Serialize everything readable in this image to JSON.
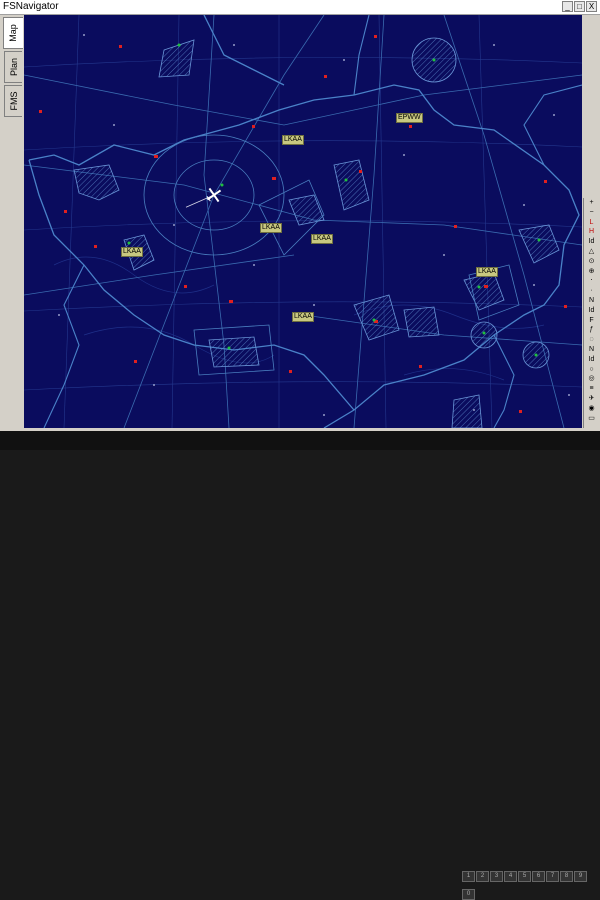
{
  "window": {
    "title": "FSNavigator"
  },
  "titlebar_buttons": [
    "_",
    "□",
    "X"
  ],
  "tabs": [
    {
      "label": "Map",
      "active": true,
      "icon": "globe-icon"
    },
    {
      "label": "Plan",
      "active": false,
      "icon": "clipboard-icon"
    },
    {
      "label": "FMS",
      "active": false,
      "icon": "document-icon"
    }
  ],
  "map": {
    "labels": [
      {
        "text": "EPWW"
      },
      {
        "text": "LKAA"
      },
      {
        "text": "LKAA"
      },
      {
        "text": "LKAA"
      },
      {
        "text": "LKAA"
      },
      {
        "text": "LKAA"
      },
      {
        "text": "LKAA"
      }
    ],
    "colors": {
      "background": "#0a0c5e",
      "border": "#4a7fc0",
      "grid": "#2a3f9a",
      "airport": "#e02020",
      "vor": "#20c040"
    }
  },
  "toolbar": {
    "buttons": [
      {
        "glyph": "+",
        "icon": "zoom-in-icon"
      },
      {
        "glyph": "−",
        "icon": "zoom-out-icon"
      },
      {
        "glyph": "L",
        "icon": "layer-l-icon"
      },
      {
        "glyph": "H",
        "icon": "layer-h-icon"
      },
      {
        "glyph": "Id",
        "icon": "ident-icon"
      },
      {
        "glyph": "△",
        "icon": "triangle-icon"
      },
      {
        "glyph": "⊙",
        "icon": "vor-icon"
      },
      {
        "glyph": "⊕",
        "icon": "ndb-icon"
      },
      {
        "glyph": "⋅",
        "icon": "dot-icon"
      },
      {
        "glyph": "·",
        "icon": "small-dot-icon"
      },
      {
        "glyph": "N",
        "icon": "n-icon"
      },
      {
        "glyph": "Id",
        "icon": "ident2-icon"
      },
      {
        "glyph": "F",
        "icon": "f-icon"
      },
      {
        "glyph": "ƒ",
        "icon": "func-icon"
      },
      {
        "glyph": "◌",
        "icon": "circle-icon"
      },
      {
        "glyph": "N",
        "icon": "n2-icon"
      },
      {
        "glyph": "Id",
        "icon": "ident3-icon"
      },
      {
        "glyph": "○",
        "icon": "ring-icon"
      },
      {
        "glyph": "◎",
        "icon": "target-icon"
      },
      {
        "glyph": "≡",
        "icon": "menu-icon"
      },
      {
        "glyph": "✈",
        "icon": "plane-icon"
      },
      {
        "glyph": "◉",
        "icon": "center-icon"
      },
      {
        "glyph": "▭",
        "icon": "box-icon"
      }
    ]
  },
  "statusbar": {
    "cells": [
      "1",
      "2",
      "3",
      "4",
      "5",
      "6",
      "7",
      "8",
      "9",
      "0"
    ]
  }
}
